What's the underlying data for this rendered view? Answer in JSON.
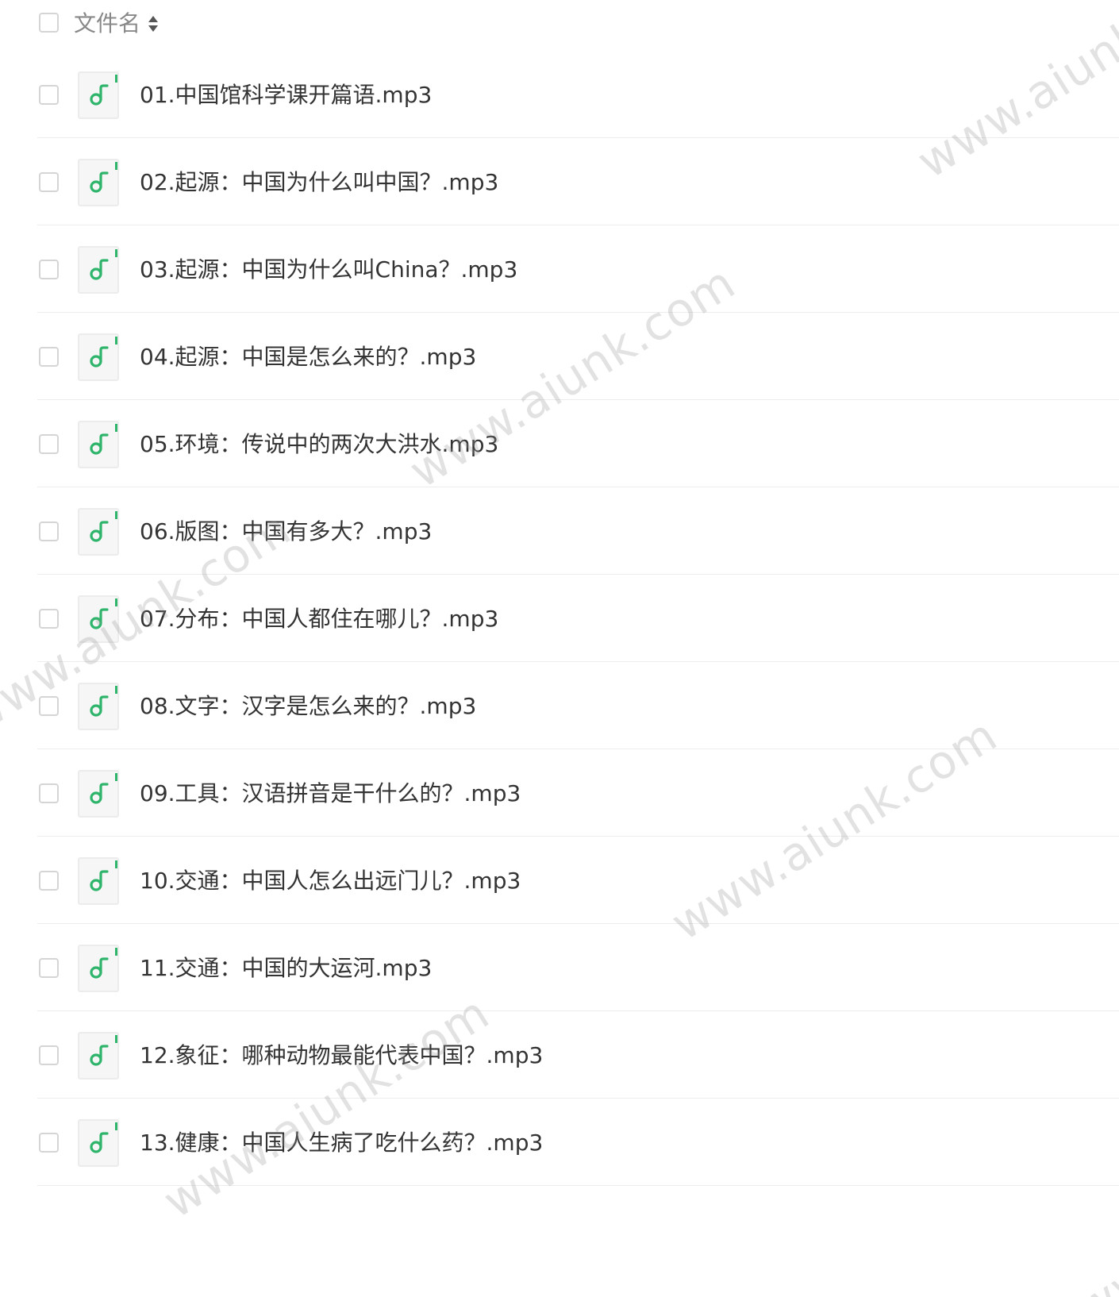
{
  "header": {
    "column_label": "文件名",
    "sort_icon": "sort-up-down-icon"
  },
  "files": [
    {
      "name": "01.中国馆科学课开篇语.mp3",
      "icon": "audio-file-icon"
    },
    {
      "name": "02.起源：中国为什么叫中国？.mp3",
      "icon": "audio-file-icon"
    },
    {
      "name": "03.起源：中国为什么叫China？.mp3",
      "icon": "audio-file-icon"
    },
    {
      "name": "04.起源：中国是怎么来的？.mp3",
      "icon": "audio-file-icon"
    },
    {
      "name": "05.环境：传说中的两次大洪水.mp3",
      "icon": "audio-file-icon"
    },
    {
      "name": "06.版图：中国有多大？.mp3",
      "icon": "audio-file-icon"
    },
    {
      "name": "07.分布：中国人都住在哪儿？.mp3",
      "icon": "audio-file-icon"
    },
    {
      "name": "08.文字：汉字是怎么来的？.mp3",
      "icon": "audio-file-icon"
    },
    {
      "name": "09.工具：汉语拼音是干什么的？.mp3",
      "icon": "audio-file-icon"
    },
    {
      "name": "10.交通：中国人怎么出远门儿？.mp3",
      "icon": "audio-file-icon"
    },
    {
      "name": "11.交通：中国的大运河.mp3",
      "icon": "audio-file-icon"
    },
    {
      "name": "12.象征：哪种动物最能代表中国？.mp3",
      "icon": "audio-file-icon"
    },
    {
      "name": "13.健康：中国人生病了吃什么药？.mp3",
      "icon": "audio-file-icon"
    }
  ],
  "watermark": {
    "text": "www.aiunk.com"
  },
  "colors": {
    "accent_green": "#2fb56b",
    "text": "#333333",
    "muted_text": "#888888",
    "divider": "#ececec"
  }
}
